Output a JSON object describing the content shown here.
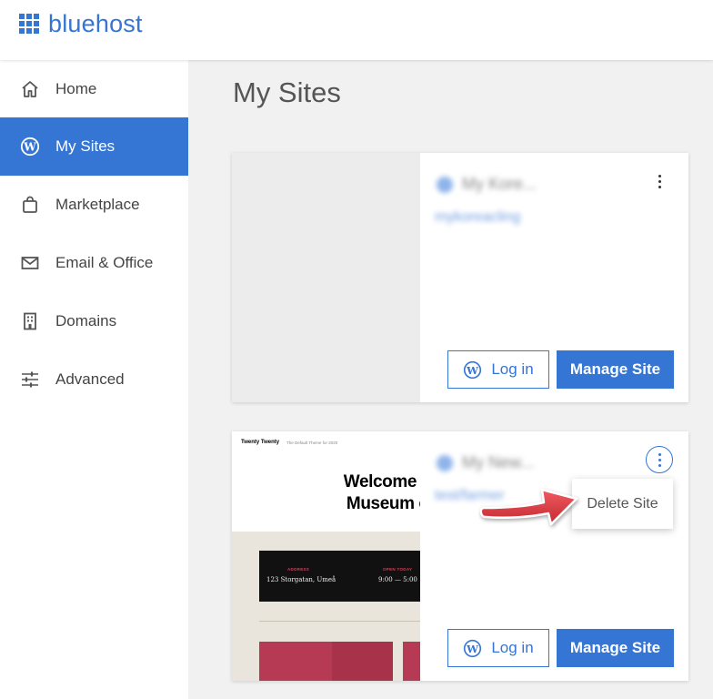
{
  "brand": {
    "name": "bluehost",
    "color": "#3575d3"
  },
  "sidebar": {
    "items": [
      {
        "label": "Home",
        "icon": "home-icon",
        "active": false
      },
      {
        "label": "My Sites",
        "icon": "wordpress-icon",
        "active": true
      },
      {
        "label": "Marketplace",
        "icon": "shopping-bag-icon",
        "active": false
      },
      {
        "label": "Email & Office",
        "icon": "envelope-icon",
        "active": false
      },
      {
        "label": "Domains",
        "icon": "building-icon",
        "active": false
      },
      {
        "label": "Advanced",
        "icon": "sliders-icon",
        "active": false
      }
    ]
  },
  "main": {
    "title": "My Sites",
    "sites": [
      {
        "name": "My Kore...",
        "url": "mykoreacling",
        "login_label": "Log in",
        "manage_label": "Manage Site"
      },
      {
        "name": "My New...",
        "url": "test/farmer",
        "login_label": "Log in",
        "manage_label": "Manage Site",
        "preview": {
          "brand": "Twenty Twenty",
          "tagline": "The Default Theme for 2020",
          "headline_line1": "Welcome to the",
          "headline_line2": "Museum of Mo",
          "address_label": "ADDRESS",
          "address_value": "123 Storgatan, Umeå",
          "open_label": "OPEN TODAY",
          "open_value": "9:00 — 5:00"
        }
      }
    ]
  },
  "dropdown": {
    "delete_label": "Delete Site"
  },
  "annotation": {
    "arrow_color": "#d9373f"
  }
}
